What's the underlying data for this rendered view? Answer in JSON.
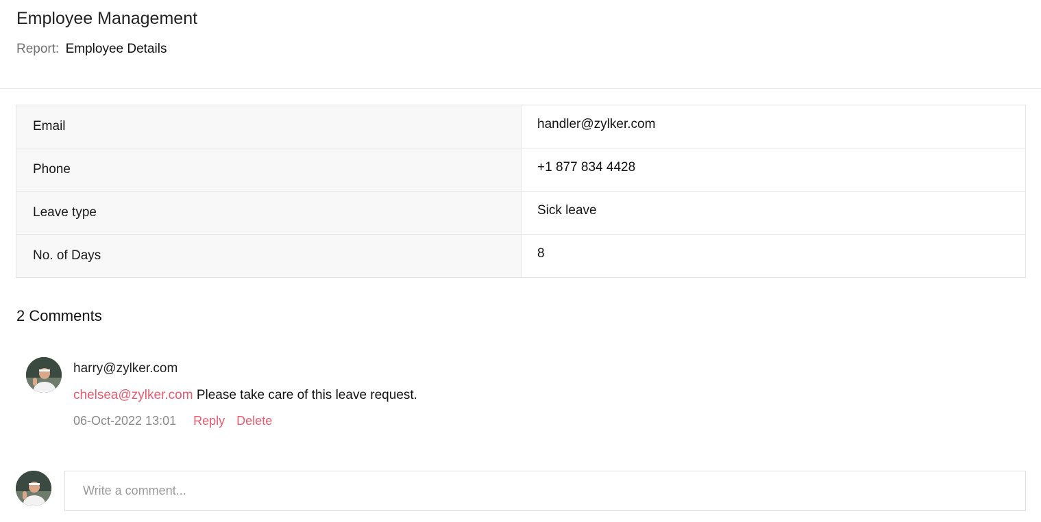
{
  "header": {
    "app_title": "Employee Management",
    "breadcrumb_label": "Report:",
    "breadcrumb_value": "Employee Details"
  },
  "details": [
    {
      "label": "Email",
      "value": "handler@zylker.com"
    },
    {
      "label": "Phone",
      "value": "+1 877 834 4428"
    },
    {
      "label": "Leave type",
      "value": "Sick leave"
    },
    {
      "label": "No. of Days",
      "value": "8"
    }
  ],
  "comments": {
    "title": "2 Comments",
    "items": [
      {
        "author": "harry@zylker.com",
        "mention": "chelsea@zylker.com",
        "text": "Please take care of this leave request.",
        "timestamp": "06-Oct-2022 13:01",
        "reply_label": "Reply",
        "delete_label": "Delete",
        "avatar_icon": "user-avatar-photo"
      }
    ],
    "input_placeholder": "Write a comment...",
    "input_value": ""
  },
  "colors": {
    "accent": "#e85a6e",
    "muted_text": "#8a8a8a",
    "label_bg": "#f8f8f8",
    "border": "#e6e6e6"
  }
}
